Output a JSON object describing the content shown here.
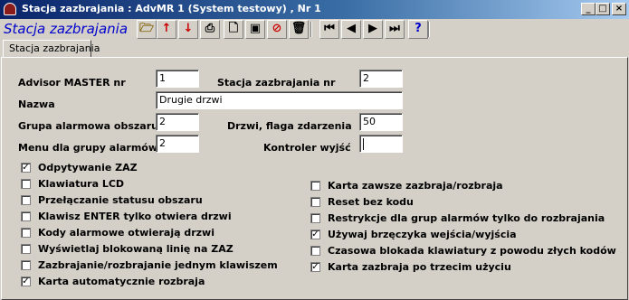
{
  "window": {
    "title": "Stacja zazbrajania : AdvMR 1 (System testowy) , Nr 1",
    "controls": {
      "minimize": "_",
      "maximize": "□",
      "close": "×"
    }
  },
  "toolbar": {
    "form_title": "Stacja zazbrajania",
    "buttons": [
      {
        "name": "open-icon",
        "glyph": "🗁",
        "color": "#806000"
      },
      {
        "name": "arrow-up-icon",
        "glyph": "↑",
        "color": "#cc0000"
      },
      {
        "name": "arrow-down-icon",
        "glyph": "↓",
        "color": "#cc0000"
      },
      {
        "name": "print-icon",
        "glyph": "⎙",
        "color": "#000000"
      },
      {
        "name": "new-document-icon",
        "glyph": "🗋",
        "color": "#000000"
      },
      {
        "name": "save-icon",
        "glyph": "▣",
        "color": "#000000"
      },
      {
        "name": "cancel-icon",
        "glyph": "⊘",
        "color": "#cc0000"
      },
      {
        "name": "delete-icon",
        "glyph": "🗑",
        "color": "#000000"
      },
      {
        "name": "first-record-icon",
        "glyph": "⏮",
        "color": "#000000"
      },
      {
        "name": "previous-record-icon",
        "glyph": "◀",
        "color": "#000000"
      },
      {
        "name": "next-record-icon",
        "glyph": "▶",
        "color": "#000000"
      },
      {
        "name": "last-record-icon",
        "glyph": "⏭",
        "color": "#000000"
      },
      {
        "name": "help-icon",
        "glyph": "?",
        "color": "#0000cc"
      }
    ]
  },
  "tabs": [
    "Stacja zazbrajania"
  ],
  "fields": {
    "advisor_master_label": "Advisor MASTER nr",
    "advisor_master_value": "1",
    "station_nr_label": "Stacja zazbrajania nr",
    "station_nr_value": "2",
    "name_label": "Nazwa",
    "name_value": "Drugie drzwi",
    "alarm_group_label": "Grupa alarmowa obszaru",
    "alarm_group_value": "2",
    "door_flag_label": "Drzwi, flaga zdarzenia",
    "door_flag_value": "50",
    "menu_group_label": "Menu dla grupy alarmów",
    "menu_group_value": "2",
    "output_controller_label": "Kontroler wyjść",
    "output_controller_value": ""
  },
  "checkboxes_left": [
    {
      "label": "Odpytywanie ZAZ",
      "checked": true
    },
    {
      "label": "Klawiatura LCD",
      "checked": false
    },
    {
      "label": "Przełączanie statusu obszaru",
      "checked": false
    },
    {
      "label": "Klawisz ENTER tylko otwiera drzwi",
      "checked": false
    },
    {
      "label": "Kody alarmowe otwierają drzwi",
      "checked": false
    },
    {
      "label": "Wyświetlaj blokowaną linię na ZAZ",
      "checked": false
    },
    {
      "label": "Zazbrajanie/rozbrajanie jednym klawiszem",
      "checked": false
    },
    {
      "label": "Karta automatycznie rozbraja",
      "checked": true
    }
  ],
  "checkboxes_right": [
    {
      "label": "Karta zawsze zazbraja/rozbraja",
      "checked": false
    },
    {
      "label": "Reset bez kodu",
      "checked": false
    },
    {
      "label": "Restrykcje dla grup alarmów tylko do rozbrajania",
      "checked": false
    },
    {
      "label": "Używaj brzęczyka wejścia/wyjścia",
      "checked": true
    },
    {
      "label": "Czasowa blokada klawiatury z powodu złych kodów",
      "checked": false
    },
    {
      "label": "Karta zazbraja po trzecim użyciu",
      "checked": true
    }
  ]
}
